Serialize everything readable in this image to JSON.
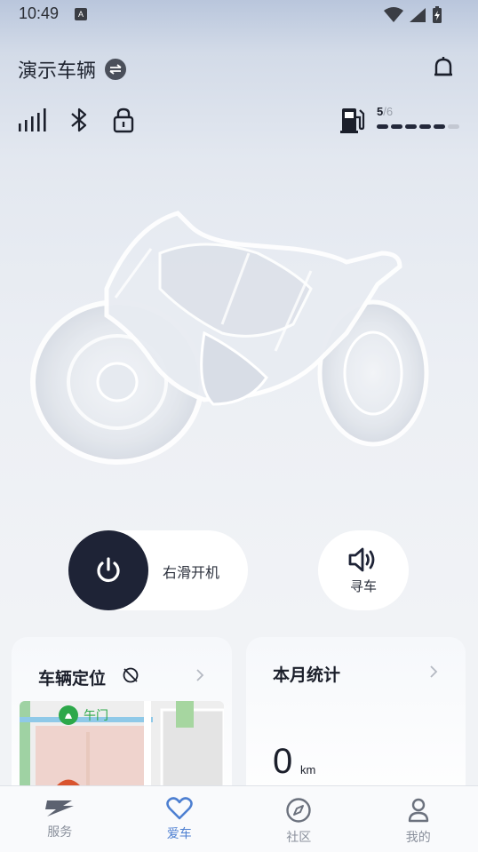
{
  "status_bar": {
    "time": "10:49",
    "input_badge": "A"
  },
  "header": {
    "vehicle_name": "演示车辆"
  },
  "fuel": {
    "level": "5",
    "separator_total": "/6",
    "filled_bars": 5,
    "total_bars": 6
  },
  "controls": {
    "slide_label": "右滑开机",
    "find_label": "寻车"
  },
  "location_card": {
    "title": "车辆定位",
    "map_label": "午门"
  },
  "stats_card": {
    "title": "本月统计",
    "value": "0",
    "unit": "km"
  },
  "nav": {
    "items": [
      {
        "label": "服务",
        "icon": "service-icon"
      },
      {
        "label": "爱车",
        "icon": "heart-icon"
      },
      {
        "label": "社区",
        "icon": "compass-icon"
      },
      {
        "label": "我的",
        "icon": "profile-icon"
      }
    ],
    "active_index": 1
  },
  "colors": {
    "accent": "#4d7fd1",
    "power_button": "#1e2336",
    "map_label_green": "#2da84a"
  }
}
